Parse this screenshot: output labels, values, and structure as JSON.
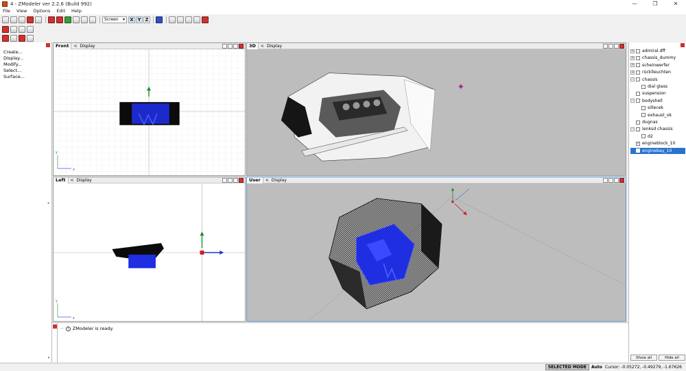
{
  "window": {
    "title": "4 - ZModeler ver 2.2.6 (Build 992)",
    "minimize": "—",
    "maximize": "❐",
    "close": "✕"
  },
  "menu": [
    "File",
    "View",
    "Options",
    "Edit",
    "Help"
  ],
  "toolbar": {
    "snap_mode": "Screen",
    "axes": [
      "X",
      "Y",
      "Z"
    ]
  },
  "left_panel": {
    "items": [
      "Create...",
      "Display...",
      "Modify...",
      "Select...",
      "Surface..."
    ]
  },
  "viewports": {
    "front": {
      "label": "Front",
      "display": "Display",
      "axis_v": "y",
      "axis_h": "x"
    },
    "three_d": {
      "label": "3D",
      "display": "Display"
    },
    "left": {
      "label": "Left",
      "display": "Display",
      "axis_v": "y",
      "axis_h": "z"
    },
    "user": {
      "label": "User",
      "display": "Display"
    }
  },
  "scene_tree": {
    "items": [
      {
        "label": "admiral.dff",
        "expander": "+",
        "checked": false,
        "indent": 0,
        "selected": false
      },
      {
        "label": "chassis_dummy",
        "expander": "+",
        "checked": false,
        "indent": 0,
        "selected": false
      },
      {
        "label": "scheinwerfer",
        "expander": "+",
        "checked": false,
        "indent": 0,
        "selected": false
      },
      {
        "label": "rücklleuchten",
        "expander": "+",
        "checked": false,
        "indent": 0,
        "selected": false
      },
      {
        "label": "chassis",
        "expander": "−",
        "checked": false,
        "indent": 0,
        "selected": false
      },
      {
        "label": "dial glass",
        "expander": "",
        "checked": false,
        "indent": 1,
        "selected": false
      },
      {
        "label": "suspension",
        "expander": "",
        "checked": false,
        "indent": 0,
        "selected": false
      },
      {
        "label": "bodyshell",
        "expander": "−",
        "checked": false,
        "indent": 0,
        "selected": false
      },
      {
        "label": "sillecek",
        "expander": "",
        "checked": false,
        "indent": 1,
        "selected": false
      },
      {
        "label": "exhaust_ok",
        "expander": "",
        "checked": false,
        "indent": 1,
        "selected": false
      },
      {
        "label": "dugnas",
        "expander": "",
        "checked": false,
        "indent": 0,
        "selected": false
      },
      {
        "label": "lenksd chassis",
        "expander": "−",
        "checked": false,
        "indent": 0,
        "selected": false
      },
      {
        "label": "d2",
        "expander": "",
        "checked": false,
        "indent": 1,
        "selected": false
      },
      {
        "label": "engineblock_10",
        "expander": "",
        "checked": true,
        "indent": 0,
        "selected": false
      },
      {
        "label": "enginebay_10",
        "expander": "",
        "checked": true,
        "indent": 0,
        "selected": true
      }
    ],
    "show_all": "Show all",
    "hide_all": "Hide all"
  },
  "log": {
    "message": "ZModeler is ready."
  },
  "status": {
    "mode": "SELECTED MODE",
    "auto": "Auto",
    "cursor": "Cursor: -0.05272, -0.49279, -1.67626"
  },
  "colors": {
    "selection": "#2a73cc",
    "mesh_blue": "#1f2ee0",
    "viewport_3d_bg": "#bdbdbd",
    "axis_green": "#1c8c2a",
    "axis_blue": "#1a3ac8",
    "axis_red": "#d02020"
  }
}
